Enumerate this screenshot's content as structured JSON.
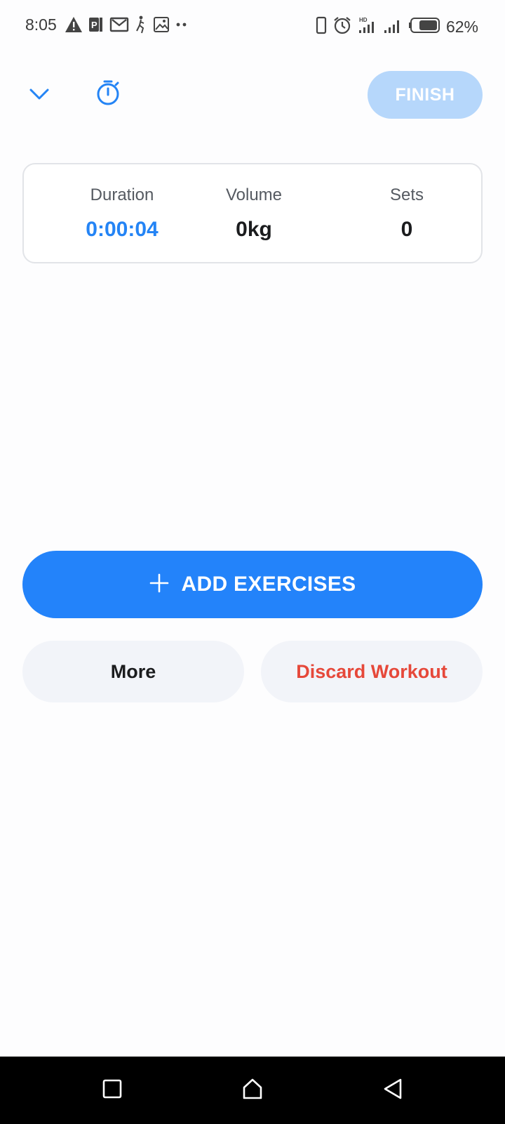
{
  "status_bar": {
    "time": "8:05",
    "left_icons": [
      "warning-icon",
      "parking-app-icon",
      "gmail-icon",
      "activity-icon",
      "gallery-icon",
      "more-dots-icon"
    ],
    "right_icons": [
      "phone-icon",
      "alarm-icon",
      "signal-hd-icon",
      "signal-icon",
      "battery-icon"
    ],
    "battery_percent": "62%"
  },
  "toolbar": {
    "collapse_icon": "chevron-down-icon",
    "timer_icon": "stopwatch-icon",
    "finish_label": "FINISH"
  },
  "stats": {
    "duration_label": "Duration",
    "duration_value": "0:00:04",
    "volume_label": "Volume",
    "volume_value": "0kg",
    "sets_label": "Sets",
    "sets_value": "0"
  },
  "actions": {
    "add_exercises_label": "ADD EXERCISES",
    "more_label": "More",
    "discard_label": "Discard Workout"
  },
  "nav_bar": {
    "icons": [
      "recents-square-icon",
      "home-icon",
      "back-triangle-icon"
    ]
  },
  "colors": {
    "accent": "#2383fa",
    "finish_disabled": "#b6d7fb",
    "danger": "#e6483a",
    "secondary_bg": "#f2f4f9"
  }
}
